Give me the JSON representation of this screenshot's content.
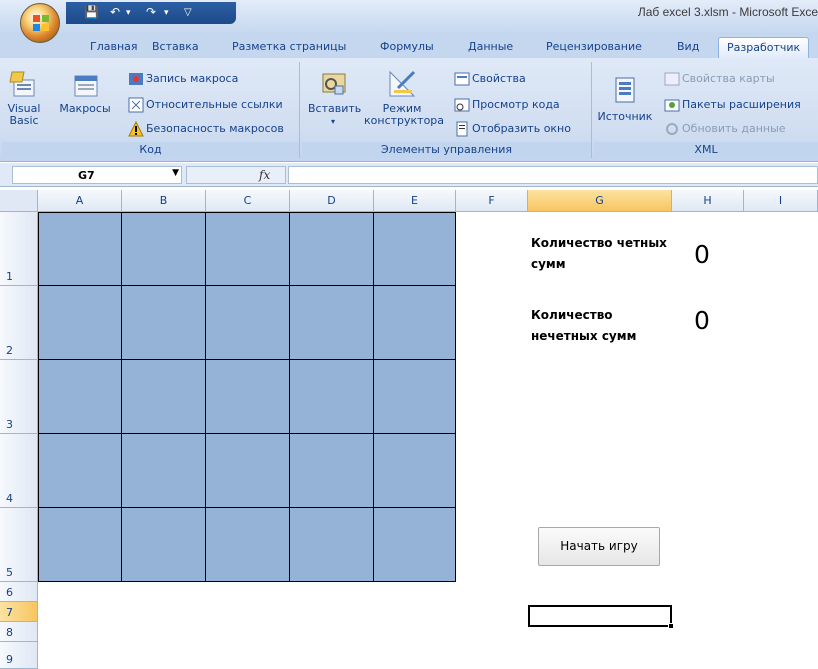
{
  "window": {
    "title": "Лаб excel 3.xlsm - Microsoft Exce"
  },
  "tabs": [
    {
      "label": "Главная"
    },
    {
      "label": "Вставка"
    },
    {
      "label": "Разметка страницы"
    },
    {
      "label": "Формулы"
    },
    {
      "label": "Данные"
    },
    {
      "label": "Рецензирование"
    },
    {
      "label": "Вид"
    },
    {
      "label": "Разработчик",
      "active": true
    }
  ],
  "ribbon": {
    "code": {
      "label": "Код",
      "visual_basic": "Visual Basic",
      "visual_basic_line1": "Visual",
      "visual_basic_line2": "Basic",
      "macros": "Макросы",
      "record_macro": "Запись макроса",
      "relative_refs": "Относительные ссылки",
      "macro_security": "Безопасность макросов"
    },
    "controls": {
      "label": "Элементы управления",
      "insert": "Вставить",
      "design_mode_line1": "Режим",
      "design_mode_line2": "конструктора",
      "properties": "Свойства",
      "view_code": "Просмотр кода",
      "run_dialog": "Отобразить окно"
    },
    "xml": {
      "label": "XML",
      "source": "Источник",
      "map_properties": "Свойства карты",
      "expansion_packs": "Пакеты расширения",
      "refresh_data": "Обновить данные"
    }
  },
  "formula_bar": {
    "name_box": "G7",
    "fx": "fx",
    "formula": ""
  },
  "columns": [
    "A",
    "B",
    "C",
    "D",
    "E",
    "F",
    "G",
    "H",
    "I"
  ],
  "selected_column": "G",
  "rows": [
    "1",
    "2",
    "3",
    "4",
    "5",
    "6",
    "7",
    "8",
    "9"
  ],
  "selected_row": "7",
  "sheet": {
    "even_label_line1": "Количество четных",
    "even_label_line2": "сумм",
    "even_count": "0",
    "odd_label_line1": "Количество",
    "odd_label_line2": "нечетных сумм",
    "odd_count": "0",
    "start_button": "Начать игру"
  },
  "colors": {
    "cell_fill": "#95b3d7",
    "ribbon_text": "#15428b",
    "selected_header": "#f8c560"
  }
}
